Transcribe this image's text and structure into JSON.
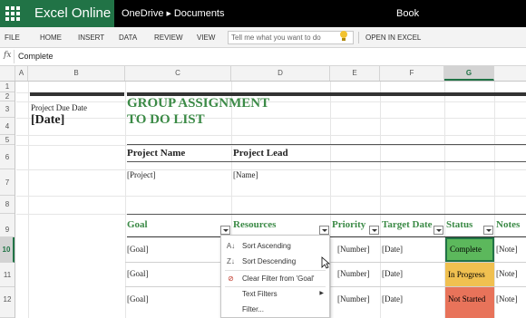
{
  "topbar": {
    "app_name": "Excel Online",
    "breadcrumb_root": "OneDrive",
    "breadcrumb_folder": "Documents",
    "doc_title": "Book"
  },
  "menu": {
    "file": "FILE",
    "home": "HOME",
    "insert": "INSERT",
    "data": "DATA",
    "review": "REVIEW",
    "view": "VIEW",
    "tell_me": "Tell me what you want to do",
    "open_in_excel": "OPEN IN EXCEL"
  },
  "formula_bar": {
    "fx": "fx",
    "value": "Complete"
  },
  "columns": [
    "A",
    "B",
    "C",
    "D",
    "E",
    "F",
    "G"
  ],
  "rows": [
    "1",
    "2",
    "3",
    "4",
    "5",
    "6",
    "7",
    "8",
    "9",
    "10",
    "11",
    "12"
  ],
  "sheet": {
    "due_label": "Project Due Date",
    "due_value": "[Date]",
    "title_line1": "GROUP ASSIGNMENT",
    "title_line2": "TO DO LIST",
    "project_name_label": "Project Name",
    "project_lead_label": "Project Lead",
    "project_value": "[Project]",
    "lead_value": "[Name]",
    "headers": {
      "goal": "Goal",
      "resources": "Resources",
      "priority": "Priority",
      "target_date": "Target Date",
      "status": "Status",
      "notes": "Notes"
    },
    "tasks": [
      {
        "goal": "[Goal]",
        "priority": "[Number]",
        "target_date": "[Date]",
        "status": "Complete",
        "notes": "[Note]"
      },
      {
        "goal": "[Goal]",
        "priority": "[Number]",
        "target_date": "[Date]",
        "status": "In Progress",
        "notes": "[Note]"
      },
      {
        "goal": "[Goal]",
        "priority": "[Number]",
        "target_date": "[Date]",
        "status": "Not Started",
        "notes": "[Note]"
      }
    ]
  },
  "filter_menu": {
    "sort_asc": "Sort Ascending",
    "sort_desc": "Sort Descending",
    "clear_filter": "Clear Filter from 'Goal'",
    "text_filters": "Text Filters",
    "filter": "Filter..."
  },
  "colors": {
    "brand": "#217346",
    "title_green": "#3b8a46",
    "complete": "#5cb85c",
    "in_progress": "#f0c050",
    "not_started": "#e8735a"
  }
}
